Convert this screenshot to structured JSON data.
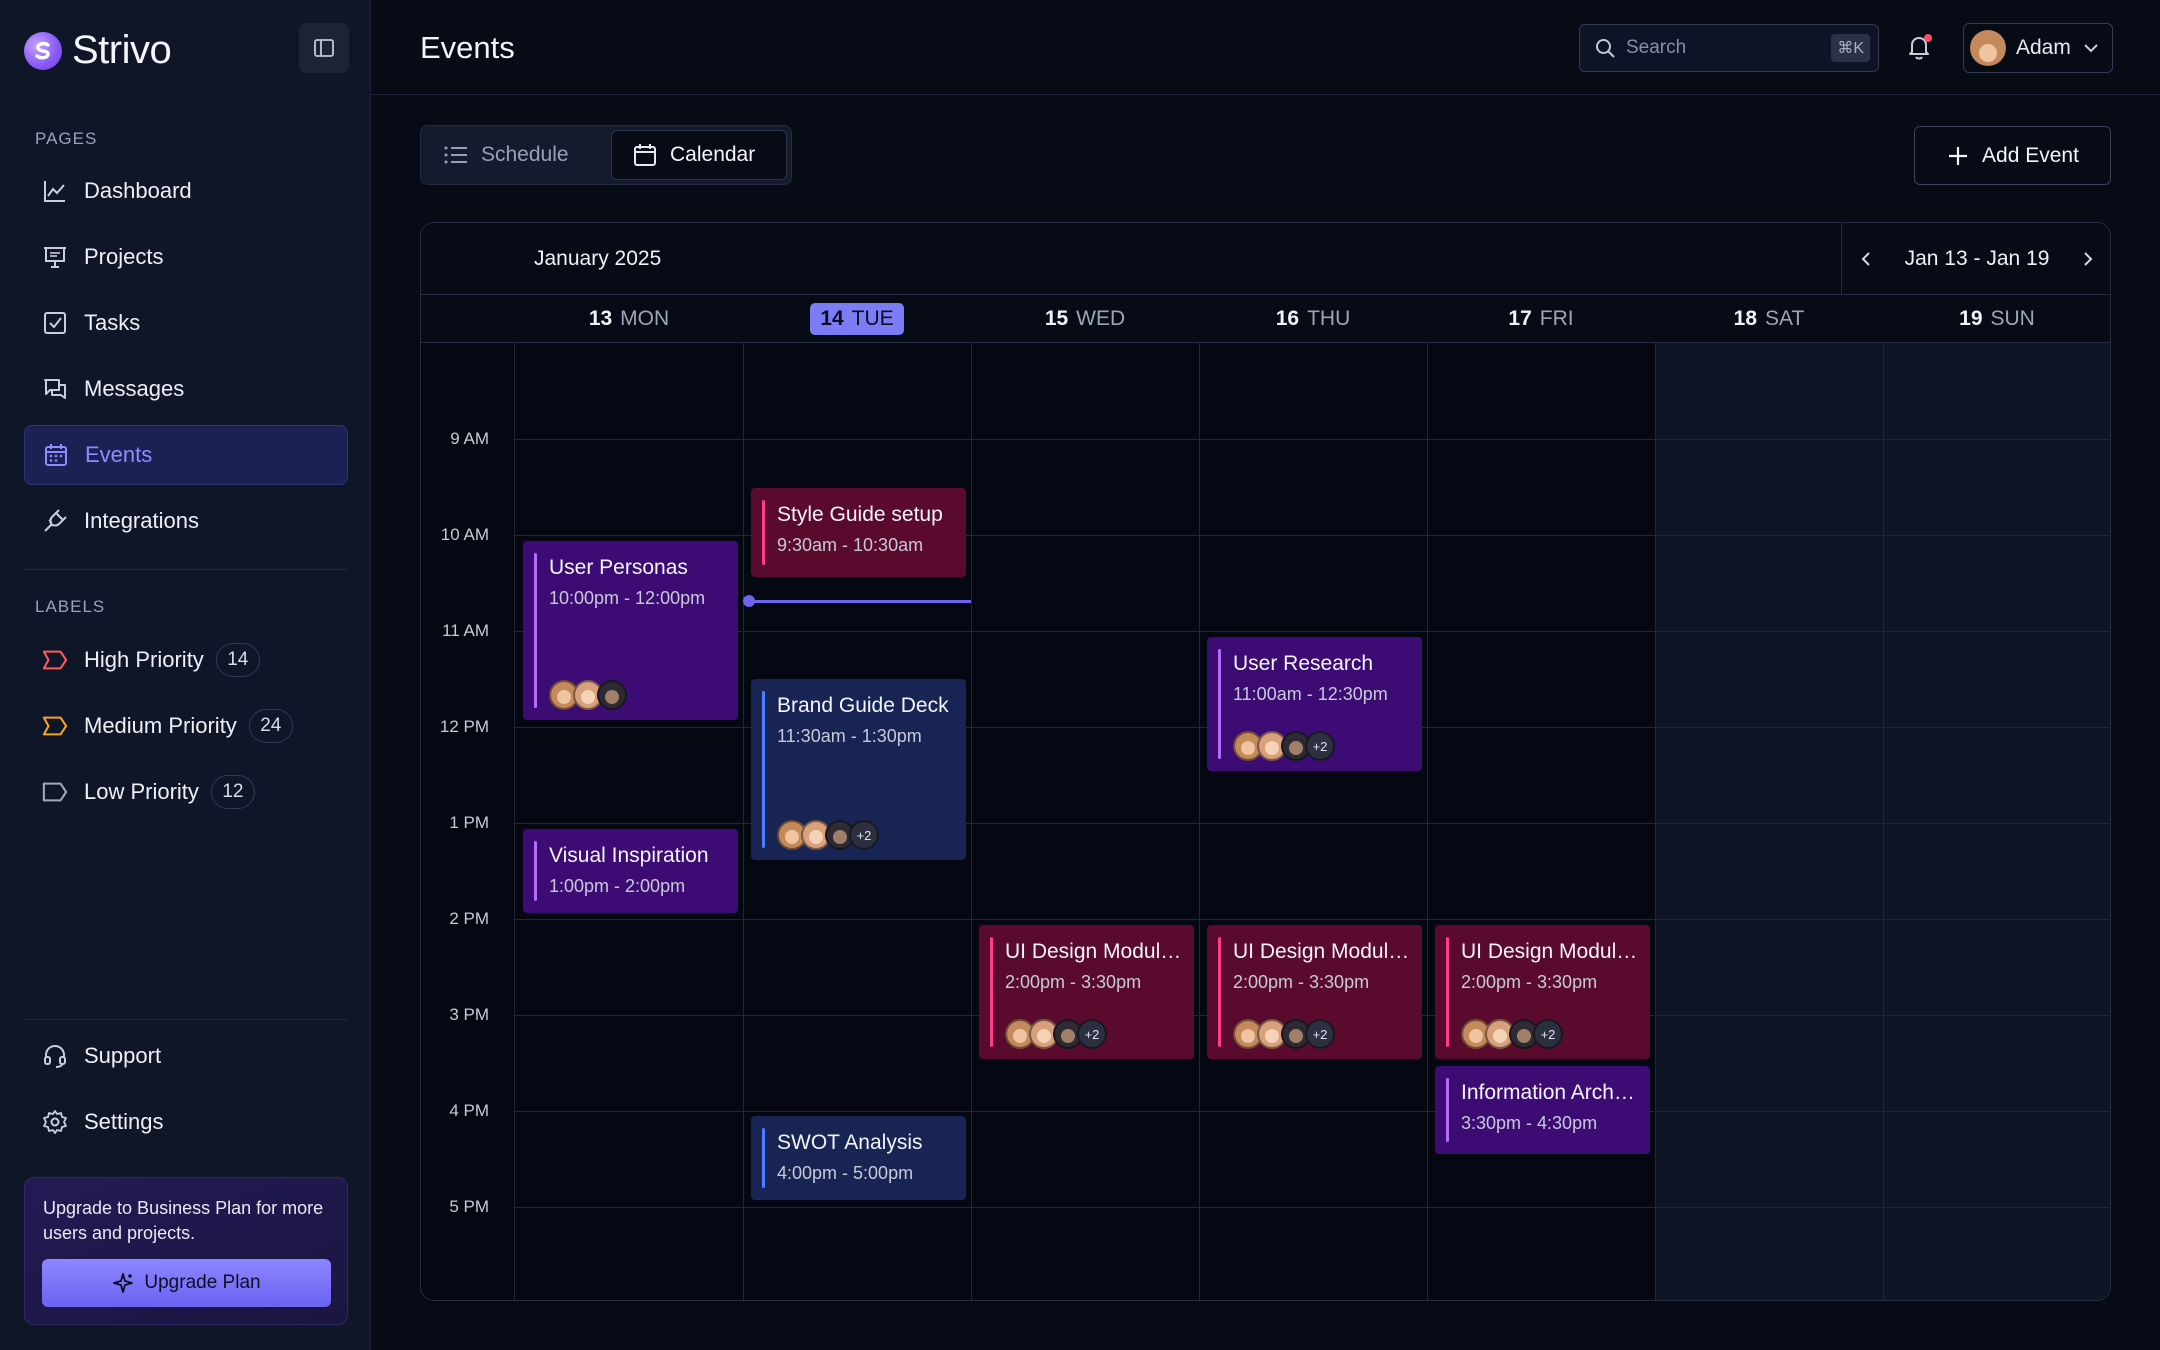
{
  "brand": {
    "name": "Strivo"
  },
  "sidebar": {
    "pages_label": "PAGES",
    "pages": [
      {
        "label": "Dashboard",
        "icon": "chart-line-icon"
      },
      {
        "label": "Projects",
        "icon": "presentation-icon"
      },
      {
        "label": "Tasks",
        "icon": "checkbox-icon"
      },
      {
        "label": "Messages",
        "icon": "messages-icon"
      },
      {
        "label": "Events",
        "icon": "calendar-icon",
        "active": true
      },
      {
        "label": "Integrations",
        "icon": "plug-icon"
      }
    ],
    "labels_label": "LABELS",
    "labels": [
      {
        "label": "High Priority",
        "count": "14",
        "color": "#ff5a5f"
      },
      {
        "label": "Medium Priority",
        "count": "24",
        "color": "#f5a524"
      },
      {
        "label": "Low Priority",
        "count": "12",
        "color": "#a3a9b8"
      }
    ],
    "footer": [
      {
        "label": "Support",
        "icon": "headset-icon"
      },
      {
        "label": "Settings",
        "icon": "gear-icon"
      }
    ],
    "upgrade": {
      "text": "Upgrade to Business Plan for more users and projects.",
      "button": "Upgrade Plan"
    }
  },
  "header": {
    "title": "Events",
    "search_placeholder": "Search",
    "search_shortcut": "⌘K",
    "user_name": "Adam"
  },
  "toolbar": {
    "schedule_label": "Schedule",
    "calendar_label": "Calendar",
    "active_view": "Calendar",
    "add_event_label": "Add Event"
  },
  "calendar": {
    "month": "January 2025",
    "range": "Jan 13 - Jan 19",
    "days": [
      {
        "num": "13",
        "name": "MON"
      },
      {
        "num": "14",
        "name": "TUE",
        "today": true
      },
      {
        "num": "15",
        "name": "WED"
      },
      {
        "num": "16",
        "name": "THU"
      },
      {
        "num": "17",
        "name": "FRI"
      },
      {
        "num": "18",
        "name": "SAT",
        "weekend": true
      },
      {
        "num": "19",
        "name": "SUN",
        "weekend": true
      }
    ],
    "times": [
      "9 AM",
      "10 AM",
      "11 AM",
      "12 PM",
      "1 PM",
      "2 PM",
      "3 PM",
      "4 PM",
      "5 PM"
    ],
    "events": [
      {
        "title": "User Personas",
        "time": "10:00pm - 12:00pm",
        "color": "purple",
        "avatars": 3,
        "more": ""
      },
      {
        "title": "Style Guide setup",
        "time": "9:30am - 10:30am",
        "color": "crimson",
        "avatars": 0,
        "more": ""
      },
      {
        "title": "Brand Guide Deck",
        "time": "11:30am - 1:30pm",
        "color": "navy",
        "avatars": 3,
        "more": "+2"
      },
      {
        "title": "User Research",
        "time": "11:00am - 12:30pm",
        "color": "purple",
        "avatars": 3,
        "more": "+2"
      },
      {
        "title": "Visual Inspiration",
        "time": "1:00pm - 2:00pm",
        "color": "purple",
        "avatars": 0,
        "more": ""
      },
      {
        "title": "UI Design Modules",
        "time": "2:00pm - 3:30pm",
        "color": "crimson",
        "avatars": 3,
        "more": "+2"
      },
      {
        "title": "UI Design Modules",
        "time": "2:00pm - 3:30pm",
        "color": "crimson",
        "avatars": 3,
        "more": "+2"
      },
      {
        "title": "UI Design Modules",
        "time": "2:00pm - 3:30pm",
        "color": "crimson",
        "avatars": 3,
        "more": "+2"
      },
      {
        "title": "Information Architecture",
        "time": "3:30pm - 4:30pm",
        "color": "purple",
        "avatars": 0,
        "more": ""
      },
      {
        "title": "SWOT Analysis",
        "time": "4:00pm - 5:00pm",
        "color": "navy",
        "avatars": 0,
        "more": ""
      }
    ]
  },
  "colors": {
    "accent": "#7c7cf5",
    "event_purple": "#3c0c74",
    "event_crimson": "#5a0a2c",
    "event_navy": "#182554"
  }
}
